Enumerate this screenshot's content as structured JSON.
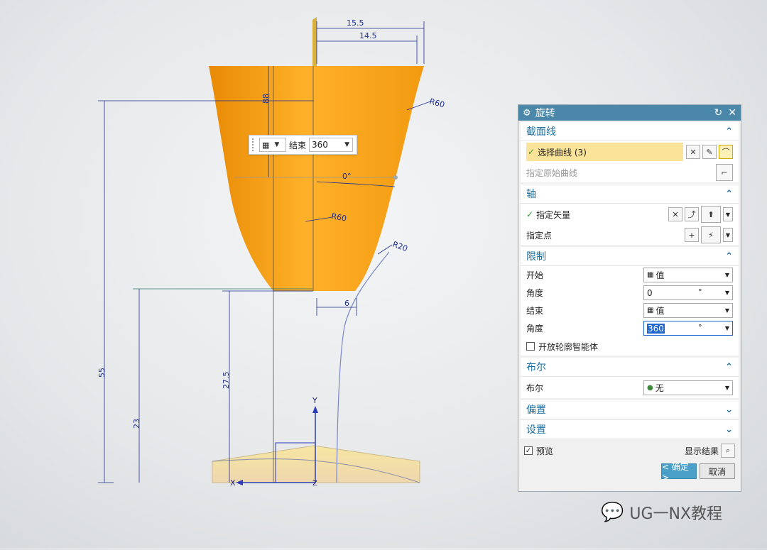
{
  "viewport": {
    "dimensions": {
      "top_outer": "15.5",
      "top_inner": "14.5",
      "cup_height": "88",
      "angle": "0°",
      "r_right_top": "R60",
      "r_inner": "R60",
      "r_bottom": "R20",
      "stem_width": "6",
      "total_height": "55",
      "stem_height": "23",
      "lower_height": "27.5"
    },
    "axes": {
      "y_label": "Y",
      "x_label": "X",
      "z_label": "Z"
    },
    "colors": {
      "body": "#f5a21b",
      "dim": "#1f2f8f"
    }
  },
  "float_bar": {
    "icon": "cube-icon",
    "end_label": "结束",
    "end_value": "360"
  },
  "dialog": {
    "title": "旋转",
    "section_curve": {
      "header": "截面线",
      "select_curve": "选择曲线 (3)",
      "specify_original": "指定原始曲线"
    },
    "section_axis": {
      "header": "轴",
      "specify_vector": "指定矢量",
      "specify_point": "指定点"
    },
    "section_limits": {
      "header": "限制",
      "start_label": "开始",
      "start_value": "值",
      "start_angle_label": "角度",
      "start_angle_value": "0",
      "end_label": "结束",
      "end_value": "值",
      "end_angle_label": "角度",
      "end_angle_value": "360",
      "degree_unit": "°",
      "open_profile": "开放轮廓智能体"
    },
    "section_boolean": {
      "header": "布尔",
      "bool_label": "布尔",
      "bool_value": "无"
    },
    "section_offset": {
      "header": "偏置"
    },
    "section_settings": {
      "header": "设置"
    },
    "preview": "预览",
    "show_result": "显示结果",
    "ok": "< 确定 >",
    "cancel": "取消"
  },
  "watermark": "UG一NX教程"
}
